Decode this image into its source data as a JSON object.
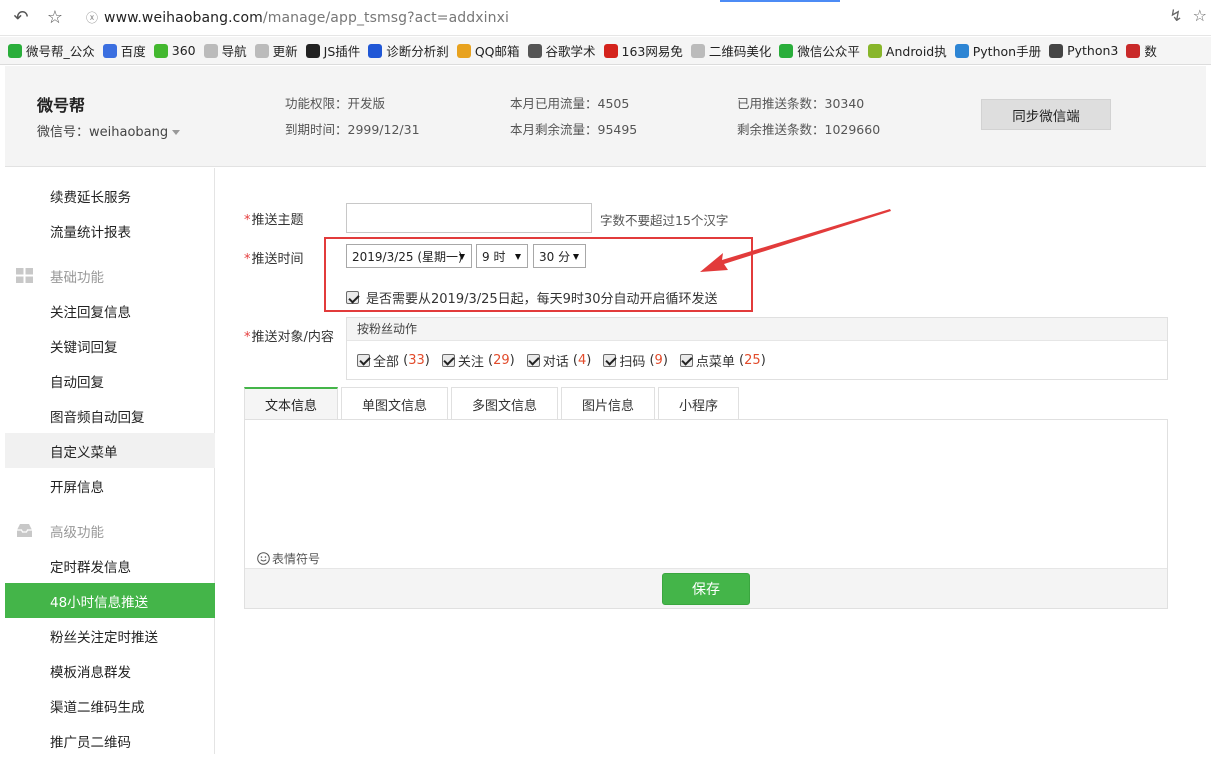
{
  "browser": {
    "url_host": "www.weihaobang.com",
    "url_path": "/manage/app_tsmsg?act=addxinxi",
    "bookmarks": [
      {
        "label": "微号帮_公众",
        "icon": "wechat-green-icon",
        "color": "#2aae3b"
      },
      {
        "label": "百度",
        "icon": "baidu-paw-icon",
        "color": "#3b6fe0"
      },
      {
        "label": "360",
        "icon": "360-icon",
        "color": "#43b82f"
      },
      {
        "label": "导航",
        "icon": "page-icon",
        "color": "#bbbbbb"
      },
      {
        "label": "更新",
        "icon": "page-icon",
        "color": "#bbbbbb"
      },
      {
        "label": "JS插件",
        "icon": "js-icon",
        "color": "#222222"
      },
      {
        "label": "诊断分析刹",
        "icon": "diagnose-icon",
        "color": "#2057d6"
      },
      {
        "label": "QQ邮箱",
        "icon": "chrome-icon",
        "color": "#e8a21e"
      },
      {
        "label": "谷歌学术",
        "icon": "google-icon",
        "color": "#555555"
      },
      {
        "label": "163网易免",
        "icon": "netease-icon",
        "color": "#d4231c"
      },
      {
        "label": "二维码美化",
        "icon": "page-icon",
        "color": "#bbbbbb"
      },
      {
        "label": "微信公众平",
        "icon": "wechat-icon",
        "color": "#2aae3b"
      },
      {
        "label": "Android执",
        "icon": "android-icon",
        "color": "#88b62b"
      },
      {
        "label": "Python手册",
        "icon": "python-icon",
        "color": "#2d85d4"
      },
      {
        "label": "Python3",
        "icon": "book-icon",
        "color": "#444444"
      },
      {
        "label": "数",
        "icon": "red-icon",
        "color": "#c92a2a"
      }
    ]
  },
  "header": {
    "brand": "微号帮",
    "account": "微信号：weihaobang",
    "stats": {
      "permission": "功能权限：开发版",
      "expire": "到期时间：2999/12/31",
      "used_traffic": "本月已用流量：4505",
      "remain_traffic": "本月剩余流量：95495",
      "used_push": "已用推送条数：30340",
      "remain_push": "剩余推送条数：1029660"
    },
    "sync_button": "同步微信端"
  },
  "sidebar": {
    "items_top": [
      "续费延长服务",
      "流量统计报表"
    ],
    "group_basic": "基础功能",
    "items_basic": [
      "关注回复信息",
      "关键词回复",
      "自动回复",
      "图音频自动回复",
      "自定义菜单",
      "开屏信息"
    ],
    "group_advanced": "高级功能",
    "items_advanced": [
      "定时群发信息",
      "48小时信息推送",
      "粉丝关注定时推送",
      "模板消息群发",
      "渠道二维码生成",
      "推广员二维码"
    ],
    "active_item": "48小时信息推送",
    "hover_item": "自定义菜单"
  },
  "form": {
    "topic_label": "推送主题",
    "topic_value": "",
    "topic_hint": "字数不要超过15个汉字",
    "time_label": "推送时间",
    "date_value": "2019/3/25 (星期一)",
    "hour_value": "9 时",
    "minute_value": "30 分",
    "loop_label": "是否需要从2019/3/25日起，每天9时30分自动开启循环发送",
    "loop_checked": true,
    "target_label": "推送对象/内容",
    "panel_title": "按粉丝动作",
    "targets": [
      {
        "label": "全部",
        "count": "33"
      },
      {
        "label": "关注",
        "count": "29"
      },
      {
        "label": "对话",
        "count": "4"
      },
      {
        "label": "扫码",
        "count": "9"
      },
      {
        "label": "点菜单",
        "count": "25"
      }
    ],
    "tabs": [
      "文本信息",
      "单图文信息",
      "多图文信息",
      "图片信息",
      "小程序"
    ],
    "active_tab": "文本信息",
    "emoji_label": "表情符号",
    "save_label": "保存"
  },
  "colors": {
    "accent": "#44b549",
    "required": "#e53c3c",
    "annotation": "#e23b3b",
    "count": "#e24b2b"
  }
}
